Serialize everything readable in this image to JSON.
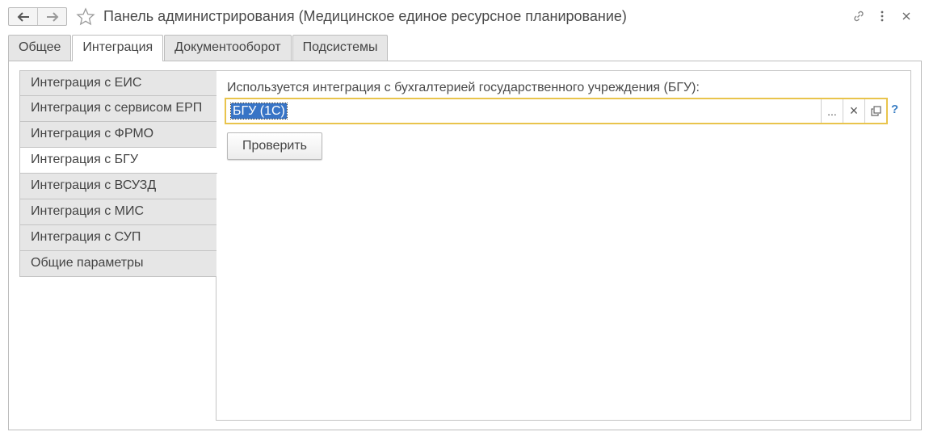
{
  "window": {
    "title": "Панель администрирования (Медицинское единое ресурсное планирование)"
  },
  "toolbar": {
    "back_icon": "arrow-left-icon",
    "forward_icon": "arrow-right-icon",
    "favorite_icon": "star-icon",
    "link_icon": "link-icon",
    "more_icon": "more-vertical-icon",
    "close_icon": "close-icon"
  },
  "tabs": [
    {
      "label": "Общее",
      "active": false
    },
    {
      "label": "Интеграция",
      "active": true
    },
    {
      "label": "Документооборот",
      "active": false
    },
    {
      "label": "Подсистемы",
      "active": false
    }
  ],
  "side_tabs": [
    {
      "label": "Интеграция с ЕИС",
      "active": false
    },
    {
      "label": "Интеграция с сервисом ЕРП",
      "active": false
    },
    {
      "label": "Интеграция с ФРМО",
      "active": false
    },
    {
      "label": "Интеграция с БГУ",
      "active": true
    },
    {
      "label": "Интеграция с ВСУЗД",
      "active": false
    },
    {
      "label": "Интеграция с МИС",
      "active": false
    },
    {
      "label": "Интеграция с СУП",
      "active": false
    },
    {
      "label": "Общие параметры",
      "active": false
    }
  ],
  "content": {
    "field_label": "Используется интеграция с бухгалтерией государственного учреждения (БГУ):",
    "field_value": "БГУ (1С)",
    "select_button": "...",
    "clear_button": "×",
    "help_label": "?",
    "check_button": "Проверить"
  },
  "colors": {
    "focus_border": "#e9c44c",
    "selection": "#3874c6",
    "help": "#3b7fc4"
  }
}
